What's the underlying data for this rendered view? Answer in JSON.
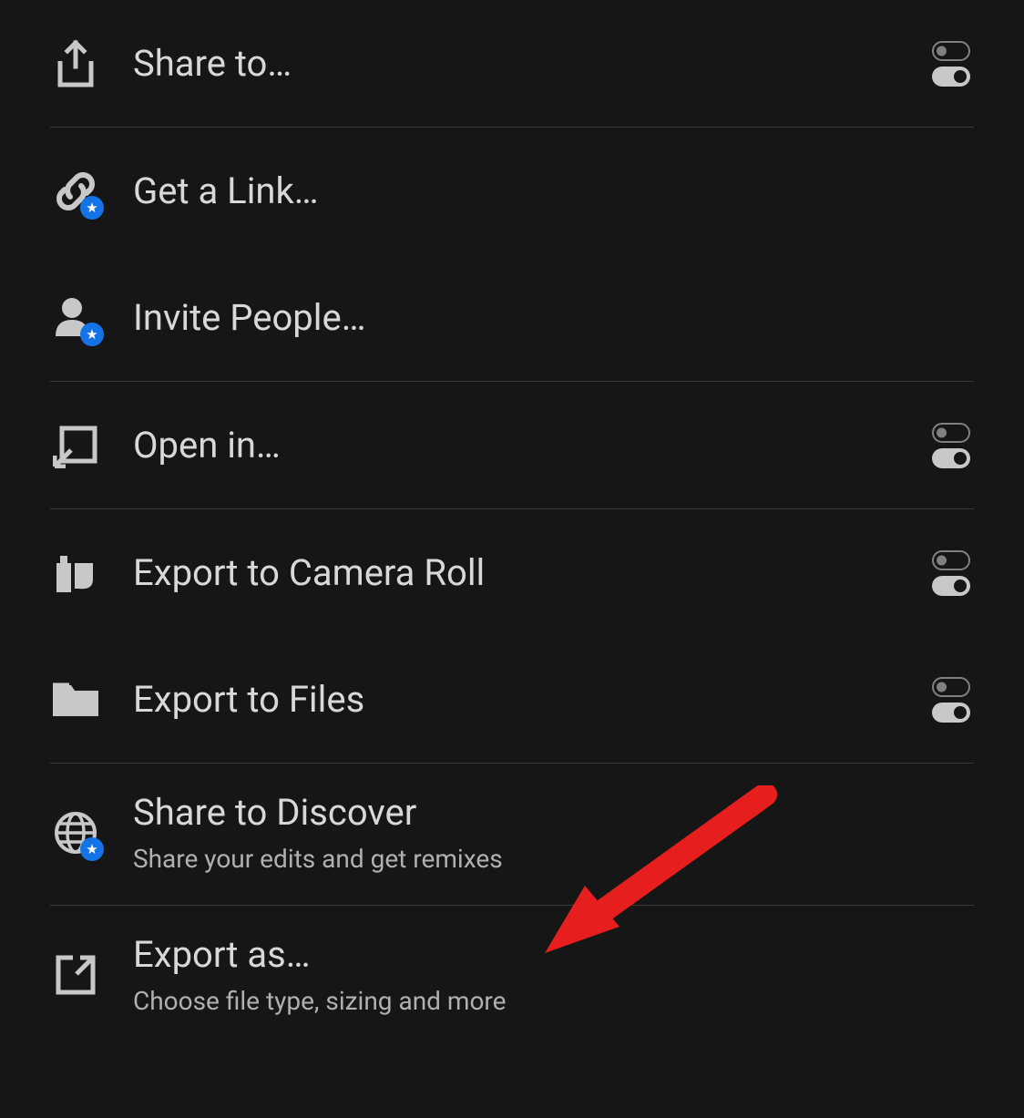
{
  "menu": {
    "items": [
      {
        "label": "Share to…",
        "has_toggle": true
      },
      {
        "label": "Get a Link…",
        "has_badge": true
      },
      {
        "label": "Invite People…",
        "has_badge": true
      },
      {
        "label": "Open in…",
        "has_toggle": true
      },
      {
        "label": "Export to Camera Roll",
        "has_toggle": true
      },
      {
        "label": "Export to Files",
        "has_toggle": true
      },
      {
        "label": "Share to Discover",
        "sublabel": "Share your edits and get remixes",
        "has_badge": true
      },
      {
        "label": "Export as…",
        "sublabel": "Choose file type, sizing and more"
      }
    ]
  }
}
